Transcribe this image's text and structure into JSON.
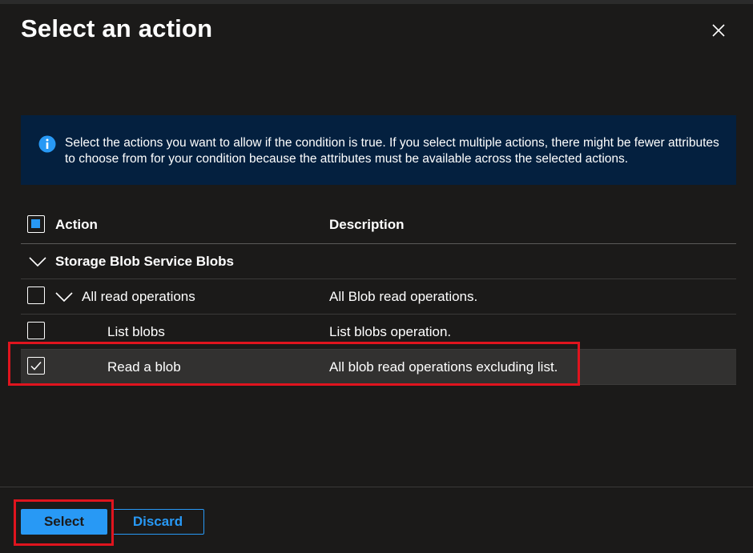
{
  "dialog": {
    "title": "Select an action",
    "close_icon": "close-icon"
  },
  "info_bar": {
    "icon": "info-icon",
    "text": "Select the actions you want to allow if the condition is true. If you select multiple actions, there might be fewer attributes to choose from for your condition because the attributes must be available across the selected actions."
  },
  "table": {
    "columns": [
      "Action",
      "Description"
    ],
    "header_checkbox_state": "partial",
    "group": {
      "label": "Storage Blob Service Blobs",
      "expanded": true
    },
    "rows": [
      {
        "action": "All read operations",
        "description": "All Blob read operations.",
        "checked": false,
        "expandable": true,
        "expanded": true,
        "indent": 1
      },
      {
        "action": "List blobs",
        "description": "List blobs operation.",
        "checked": false,
        "expandable": false,
        "indent": 2
      },
      {
        "action": "Read a blob",
        "description": "All blob read operations excluding list.",
        "checked": true,
        "expandable": false,
        "indent": 2,
        "selected": true
      }
    ]
  },
  "footer": {
    "select_label": "Select",
    "discard_label": "Discard"
  },
  "colors": {
    "background": "#1b1a19",
    "accent": "#2899f5",
    "info_background": "#04203f",
    "annotation": "#e0141e"
  }
}
